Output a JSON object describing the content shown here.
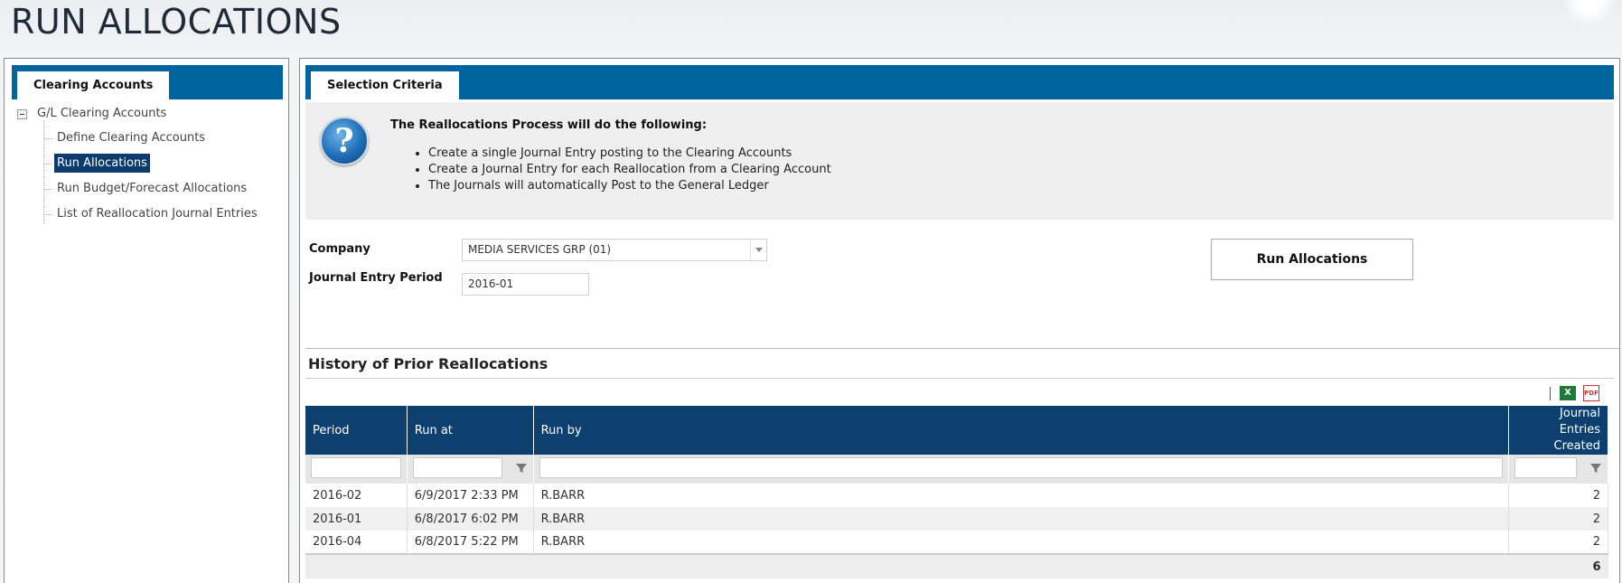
{
  "page": {
    "title": "RUN ALLOCATIONS"
  },
  "left_panel": {
    "tab_label": "Clearing Accounts",
    "tree": {
      "root_label": "G/L Clearing Accounts",
      "items": [
        {
          "label": "Define Clearing Accounts",
          "selected": false
        },
        {
          "label": "Run Allocations",
          "selected": true
        },
        {
          "label": "Run Budget/Forecast Allocations",
          "selected": false
        },
        {
          "label": "List of Reallocation Journal Entries",
          "selected": false
        }
      ]
    }
  },
  "right_panel": {
    "tab_label": "Selection Criteria",
    "info": {
      "heading": "The Reallocations Process will do the following:",
      "bullets": [
        "Create a single Journal Entry posting to the Clearing Accounts",
        "Create a Journal Entry for each Reallocation from a Clearing Account",
        "The Journals will automatically Post to the General Ledger"
      ]
    },
    "form": {
      "company_label": "Company",
      "company_value": "MEDIA SERVICES GRP (01)",
      "period_label": "Journal Entry Period",
      "period_value": "2016-01",
      "run_button": "Run Allocations"
    },
    "history": {
      "title": "History of Prior Reallocations",
      "columns": [
        "Period",
        "Run at",
        "Run by",
        "Journal Entries Created"
      ],
      "rows": [
        {
          "period": "2016-02",
          "run_at": "6/9/2017 2:33 PM",
          "run_by": "R.BARR",
          "entries": "2"
        },
        {
          "period": "2016-01",
          "run_at": "6/8/2017 6:02 PM",
          "run_by": "R.BARR",
          "entries": "2"
        },
        {
          "period": "2016-04",
          "run_at": "6/8/2017 5:22 PM",
          "run_by": "R.BARR",
          "entries": "2"
        }
      ],
      "total": "6",
      "export_icons": [
        "excel-icon",
        "pdf-icon"
      ]
    }
  },
  "colors": {
    "tab_bar": "#00659e",
    "grid_header": "#0d3f6f",
    "selected_item": "#0c3c6e"
  }
}
